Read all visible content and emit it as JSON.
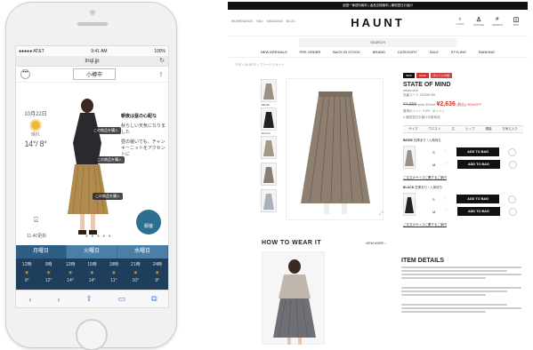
{
  "phone": {
    "status": {
      "carrier": "●●●●● AT&T",
      "time": "9:41 AM",
      "battery": "100%"
    },
    "url": "tnql.jp",
    "city": "小樽市",
    "weather": {
      "date": "10月22日",
      "condition": "晴れ",
      "temp": "14°/ 8°"
    },
    "description": [
      {
        "text": "朝夜は昼の心配な",
        "bold": true
      },
      {
        "text": "秋らしい天気になりました",
        "bold": false
      },
      {
        "text": "昼の装いでも、チャンキーニットをアクセントに",
        "bold": false
      }
    ],
    "tags": [
      "この商品を購入",
      "この商品を購入",
      "この商品を購入"
    ],
    "updated": "11:40更新",
    "pager": "● ● ● ● ●",
    "badge": "服装",
    "tabs": [
      "月曜日",
      "火曜日",
      "水曜日"
    ],
    "hourly": [
      {
        "time": "12時",
        "temp": "9°"
      },
      {
        "time": "9時",
        "temp": "12°"
      },
      {
        "time": "12時",
        "temp": "14°"
      },
      {
        "time": "15時",
        "temp": "14°"
      },
      {
        "time": "18時",
        "temp": "11°"
      },
      {
        "time": "21時",
        "temp": "10°"
      },
      {
        "time": "24時",
        "temp": "9°"
      }
    ],
    "toolbar": [
      "‹",
      "›",
      "⇪",
      "▭",
      "⧉"
    ]
  },
  "web": {
    "banner": "全国一律送料無料 | 返品交換無料 | 最短翌日お届け",
    "subnav": "WOMEN&KIDS HAU MAGAZINE BLOG",
    "logo": "HAUNT",
    "icons": [
      {
        "glyph": "♁",
        "label": "LOGIN"
      },
      {
        "glyph": "♙",
        "label": "MYPAGE"
      },
      {
        "glyph": "⌕",
        "label": "SEARCH"
      },
      {
        "glyph": "◫",
        "label": "BAG"
      }
    ],
    "search": "SEARCH",
    "categories": [
      "NEW ARRIVALS",
      "PRE ORDER",
      "BACK IN STOCK",
      "BRAND",
      "CATEGORY",
      "SALE",
      "STYLING",
      "RANKING"
    ],
    "breadcrumb": "TOP > SKIRTS > プリーツスカート",
    "thumb_labels": [
      "BEIGE",
      "BLACK"
    ],
    "chips": [
      {
        "label": "NEW",
        "color": "#111"
      },
      {
        "label": "SALE",
        "color": "#d0342c"
      },
      {
        "label": "ポイント10倍",
        "color": "#c44"
      }
    ],
    "product": {
      "brand": "STATE OF MIND",
      "sub": "pleats skirt",
      "code": "品番コード 123456789",
      "old_price": "¥4,890",
      "price_label": "price 30%off",
      "new_price": "¥2,636",
      "discount": "(税込) 30%OFF",
      "points": "獲得ポイント 9.6% · ポイント",
      "delivery": "● 最短翌日お届け対象商品"
    },
    "size_table": [
      "サイズ",
      "ウエスト",
      "丈",
      "ヒップ",
      "裾幅",
      "お気に入り"
    ],
    "colors": [
      {
        "name": "BEIGE",
        "note": "在庫あり / 入荷待ち",
        "sizes": [
          "S",
          "M"
        ],
        "bag": "ADD TO BAG",
        "link": "ご注文のサイズに関するご案内"
      },
      {
        "name": "BLACK",
        "note": "在庫あり / 入荷待ち",
        "sizes": [
          "S",
          "M"
        ],
        "bag": "ADD TO BAG",
        "link": "ご注文のサイズに関するご案内"
      }
    ],
    "howto": "HOW TO WEAR IT",
    "viewmore": "VIEW MORE ›",
    "details_title": "ITEM DETAILS"
  }
}
